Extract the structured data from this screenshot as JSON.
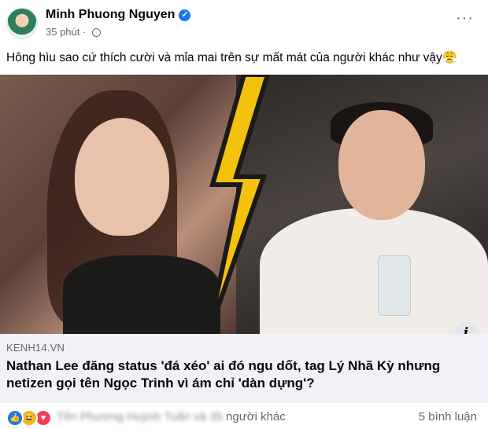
{
  "post": {
    "author": "Minh Phuong Nguyen",
    "time": "35 phút",
    "dot": "·",
    "more": "···",
    "text": "Hông hìu sao cứ thích cười và mỉa mai trên sự mất mát của người khác như vậy😤"
  },
  "link": {
    "domain": "KENH14.VN",
    "title": "Nathan Lee đăng status 'đá xéo' ai đó ngu dốt, tag Lý Nhã Kỳ nhưng netizen gọi tên Ngọc Trinh vì ám chỉ 'dàn dựng'?",
    "info": "i"
  },
  "reactions": {
    "names_blurred": "Tên Phương Huỳnh Tuấn và 35",
    "names_suffix": " người khác",
    "comments": "5 bình luận"
  },
  "colors": {
    "brand": "#1877f2",
    "secondary_text": "#65676b",
    "link_bg": "#f0f2f5"
  },
  "icons": [
    "verified-icon",
    "globe-icon",
    "more-icon",
    "info-icon",
    "like-icon",
    "haha-icon",
    "love-icon"
  ]
}
